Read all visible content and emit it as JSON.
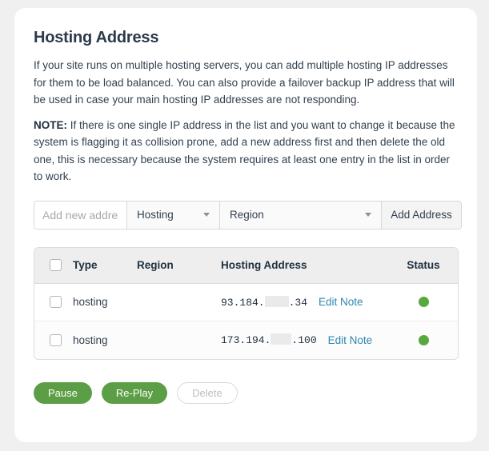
{
  "page": {
    "title": "Hosting Address",
    "paragraph_1": "If your site runs on multiple hosting servers, you can add multiple hosting IP addresses for them to be load balanced. You can also provide a failover backup IP address that will be used in case your main hosting IP addresses are not responding.",
    "note_label": "NOTE:",
    "note_text": " If there is one single IP address in the list and you want to change it because the system is flagging it as collision prone, add a new address first and then delete the old one, this is necessary because the system requires at least one entry in the list in order to work."
  },
  "form": {
    "address_input": {
      "value": "",
      "placeholder": "Add new address"
    },
    "type_select": {
      "selected": "Hosting",
      "caret_icon": "chevron-down-icon"
    },
    "region_select": {
      "selected": "Region",
      "caret_icon": "chevron-down-icon"
    },
    "add_button": "Add Address"
  },
  "table": {
    "columns": {
      "select_all": "",
      "type": "Type",
      "region": "Region",
      "address": "Hosting Address",
      "status": "Status"
    },
    "rows": [
      {
        "type": "hosting",
        "region": "",
        "address_prefix": "93.184.",
        "address_suffix": ".34",
        "address_redacted": true,
        "edit_link": "Edit Note",
        "status": "online",
        "status_color": "#57a93f"
      },
      {
        "type": "hosting",
        "region": "",
        "address_prefix": "173.194.",
        "address_suffix": ".100",
        "address_redacted": true,
        "edit_link": "Edit Note",
        "status": "online",
        "status_color": "#57a93f"
      }
    ]
  },
  "actions": {
    "pause": "Pause",
    "replay": "Re-Play",
    "delete": "Delete"
  },
  "colors": {
    "accent_green": "#5c9e45",
    "status_green": "#57a93f",
    "link_blue": "#2e87b0",
    "text_dark": "#33414f"
  }
}
